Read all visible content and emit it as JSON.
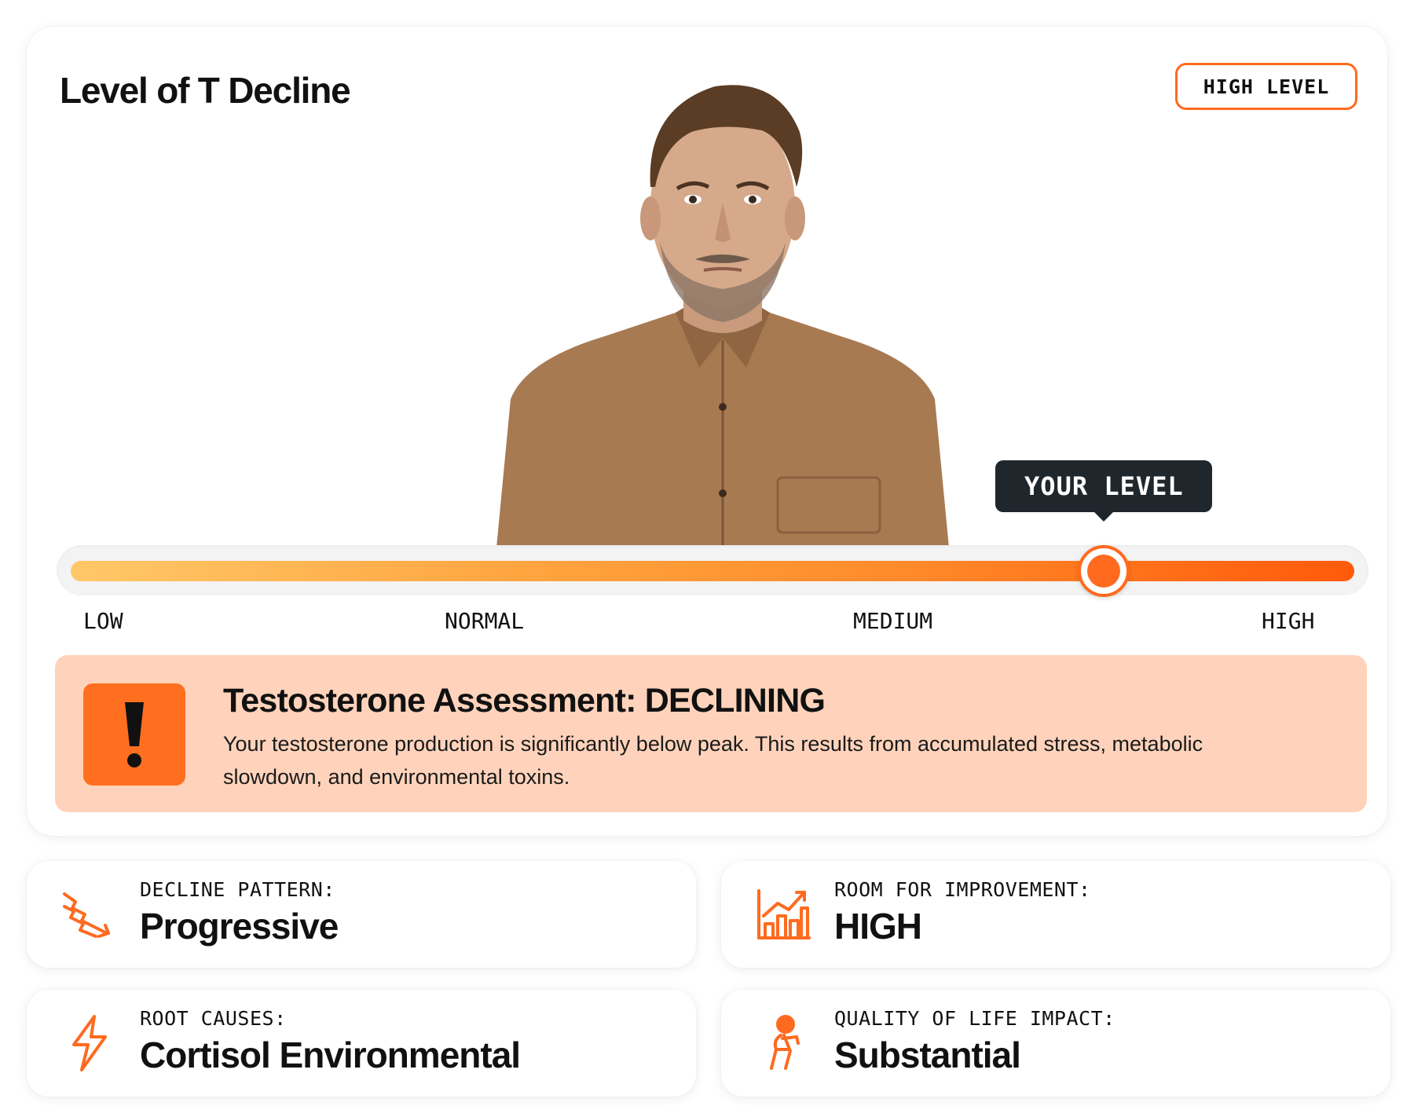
{
  "card": {
    "title": "Level of T Decline",
    "badge": "HIGH LEVEL"
  },
  "slider": {
    "tooltip": "YOUR LEVEL",
    "value_fraction": 0.805,
    "labels": [
      "LOW",
      "NORMAL",
      "MEDIUM",
      "HIGH"
    ]
  },
  "assessment": {
    "title": "Testosterone Assessment: DECLINING",
    "body": "Your testosterone production is significantly below peak. This results from accumulated stress, metabolic slowdown, and environmental toxins.",
    "icon": "exclamation-icon"
  },
  "stats": [
    {
      "icon": "declining-zigzag-arrow-icon",
      "label": "DECLINE PATTERN:",
      "value": "Progressive"
    },
    {
      "icon": "growth-chart-icon",
      "label": "ROOM FOR IMPROVEMENT:",
      "value": "HIGH"
    },
    {
      "icon": "lightning-bolt-icon",
      "label": "ROOT CAUSES:",
      "value": "Cortisol Environmental"
    },
    {
      "icon": "tired-person-icon",
      "label": "QUALITY OF LIFE IMPACT:",
      "value": "Substantial"
    }
  ],
  "colors": {
    "accent": "#ff6a1f",
    "assessment_bg": "#ffd3bb",
    "tooltip_bg": "#1f262c",
    "gradient_start": "#ffc768",
    "gradient_end": "#ff5a0a"
  }
}
